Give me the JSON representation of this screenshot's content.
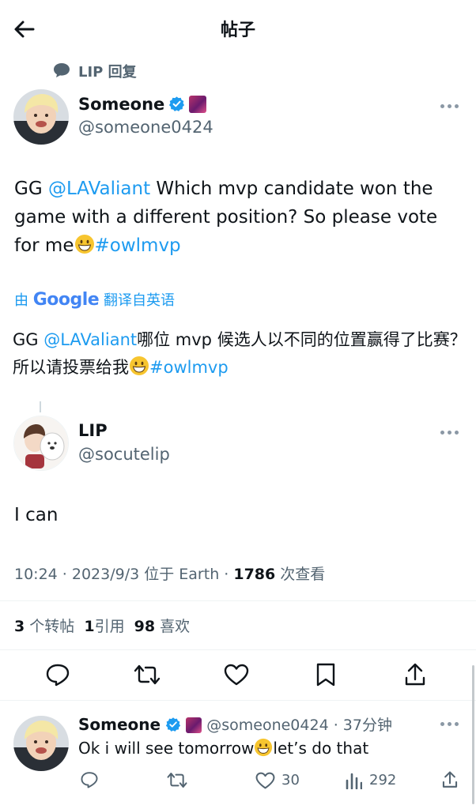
{
  "header": {
    "title": "帖子"
  },
  "reply_context": {
    "text": "LIP 回复"
  },
  "main_post": {
    "display_name": "Someone",
    "handle": "@someone0424",
    "text_prefix": "GG ",
    "mention": "@LAValiant",
    "text_middle": "  Which mvp candidate won the game with a different position? So please vote for me",
    "hashtag": "#owlmvp"
  },
  "translation": {
    "prefix": "由",
    "engine": "Google",
    "suffix": "翻译自英语",
    "text_prefix": "GG ",
    "mention": "@LAValiant",
    "text_middle": "哪位 mvp 候选人以不同的位置赢得了比赛？所以请投票给我",
    "hashtag": "#owlmvp"
  },
  "reply_post": {
    "display_name": "LIP",
    "handle": "@socutelip",
    "text": "I can",
    "time": "10:24 · 2023/9/3 位于 Earth · ",
    "views_count": "1786",
    "views_label": " 次查看"
  },
  "stats": {
    "reposts_count": "3",
    "reposts_label": " 个转帖",
    "quotes_count": "1",
    "quotes_label": "引用",
    "likes_count": "98",
    "likes_label": " 喜欢"
  },
  "bottom_reply": {
    "display_name": "Someone",
    "handle": "@someone0424",
    "time": " · 37分钟",
    "text_before": "Ok i will see tomorrow",
    "text_after": "let’s do that",
    "likes": "30",
    "views": "292"
  },
  "icons": {
    "back": "arrow-left-icon",
    "reply": "speech-bubble-icon",
    "retweet": "retweet-icon",
    "like": "heart-icon",
    "bookmark": "bookmark-icon",
    "share": "share-icon",
    "views": "bar-chart-icon",
    "verified": "verified-badge-icon",
    "more": "more-dots-icon"
  },
  "colors": {
    "link": "#1d9bf0",
    "muted": "#536471",
    "text": "#0f1419"
  }
}
